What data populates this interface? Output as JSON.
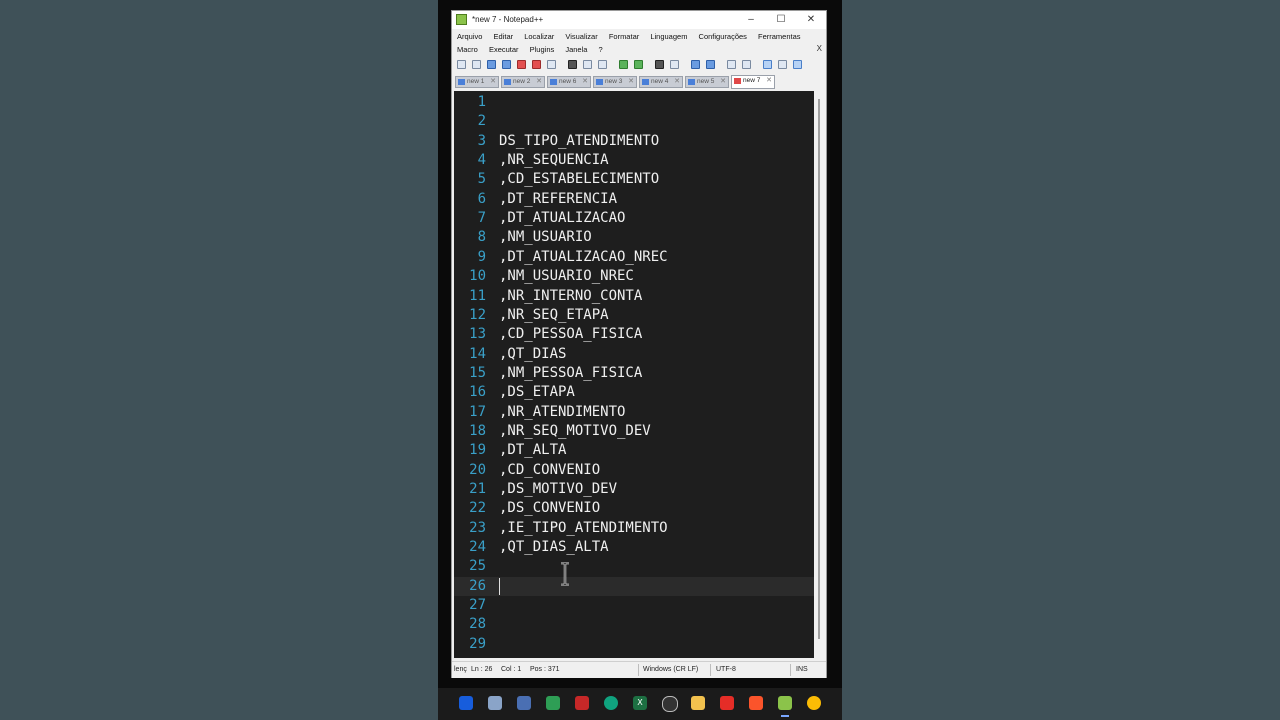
{
  "window": {
    "title": "*new 7 - Notepad++",
    "minimize": "–",
    "maximize": "☐",
    "close": "✕"
  },
  "menu": {
    "row1": [
      "Arquivo",
      "Editar",
      "Localizar",
      "Visualizar",
      "Formatar",
      "Linguagem",
      "Configurações",
      "Ferramentas"
    ],
    "row2": [
      "Macro",
      "Executar",
      "Plugins",
      "Janela",
      "?"
    ],
    "close": "X"
  },
  "tabs": [
    {
      "label": "new 1",
      "close": "✕"
    },
    {
      "label": "new 2",
      "close": "✕"
    },
    {
      "label": "new 6",
      "close": "✕"
    },
    {
      "label": "new 3",
      "close": "✕"
    },
    {
      "label": "new 4",
      "close": "✕"
    },
    {
      "label": "new 5",
      "close": "✕"
    },
    {
      "label": "new 7",
      "close": "✕",
      "active": true
    }
  ],
  "editor": {
    "current_line": 26,
    "lines": [
      {
        "num": "1",
        "text": ""
      },
      {
        "num": "2",
        "text": ""
      },
      {
        "num": "3",
        "text": "DS_TIPO_ATENDIMENTO"
      },
      {
        "num": "4",
        "text": ",NR_SEQUENCIA"
      },
      {
        "num": "5",
        "text": ",CD_ESTABELECIMENTO"
      },
      {
        "num": "6",
        "text": ",DT_REFERENCIA"
      },
      {
        "num": "7",
        "text": ",DT_ATUALIZACAO"
      },
      {
        "num": "8",
        "text": ",NM_USUARIO"
      },
      {
        "num": "9",
        "text": ",DT_ATUALIZACAO_NREC"
      },
      {
        "num": "10",
        "text": ",NM_USUARIO_NREC"
      },
      {
        "num": "11",
        "text": ",NR_INTERNO_CONTA"
      },
      {
        "num": "12",
        "text": ",NR_SEQ_ETAPA"
      },
      {
        "num": "13",
        "text": ",CD_PESSOA_FISICA"
      },
      {
        "num": "14",
        "text": ",QT_DIAS"
      },
      {
        "num": "15",
        "text": ",NM_PESSOA_FISICA"
      },
      {
        "num": "16",
        "text": ",DS_ETAPA"
      },
      {
        "num": "17",
        "text": ",NR_ATENDIMENTO"
      },
      {
        "num": "18",
        "text": ",NR_SEQ_MOTIVO_DEV"
      },
      {
        "num": "19",
        "text": ",DT_ALTA"
      },
      {
        "num": "20",
        "text": ",CD_CONVENIO"
      },
      {
        "num": "21",
        "text": ",DS_MOTIVO_DEV"
      },
      {
        "num": "22",
        "text": ",DS_CONVENIO"
      },
      {
        "num": "23",
        "text": ",IE_TIPO_ATENDIMENTO"
      },
      {
        "num": "24",
        "text": ",QT_DIAS_ALTA"
      },
      {
        "num": "25",
        "text": ""
      },
      {
        "num": "26",
        "text": ""
      },
      {
        "num": "27",
        "text": ""
      },
      {
        "num": "28",
        "text": ""
      },
      {
        "num": "29",
        "text": ""
      }
    ]
  },
  "status": {
    "length": "lenç",
    "ln": "Ln : 26",
    "col": "Col : 1",
    "pos": "Pos : 371",
    "eol": "Windows (CR LF)",
    "encoding": "UTF-8",
    "mode": "INS"
  },
  "taskbar": {
    "icons": [
      "bitwarden-icon",
      "mail-icon",
      "virtualbox-icon",
      "sheets-icon",
      "filezilla-icon",
      "chatgpt-icon",
      "excel-icon",
      "github-icon",
      "folder-icon",
      "youtube-icon",
      "brave-icon",
      "notepadpp-icon",
      "chrome-icon"
    ],
    "excel_label": "X"
  }
}
